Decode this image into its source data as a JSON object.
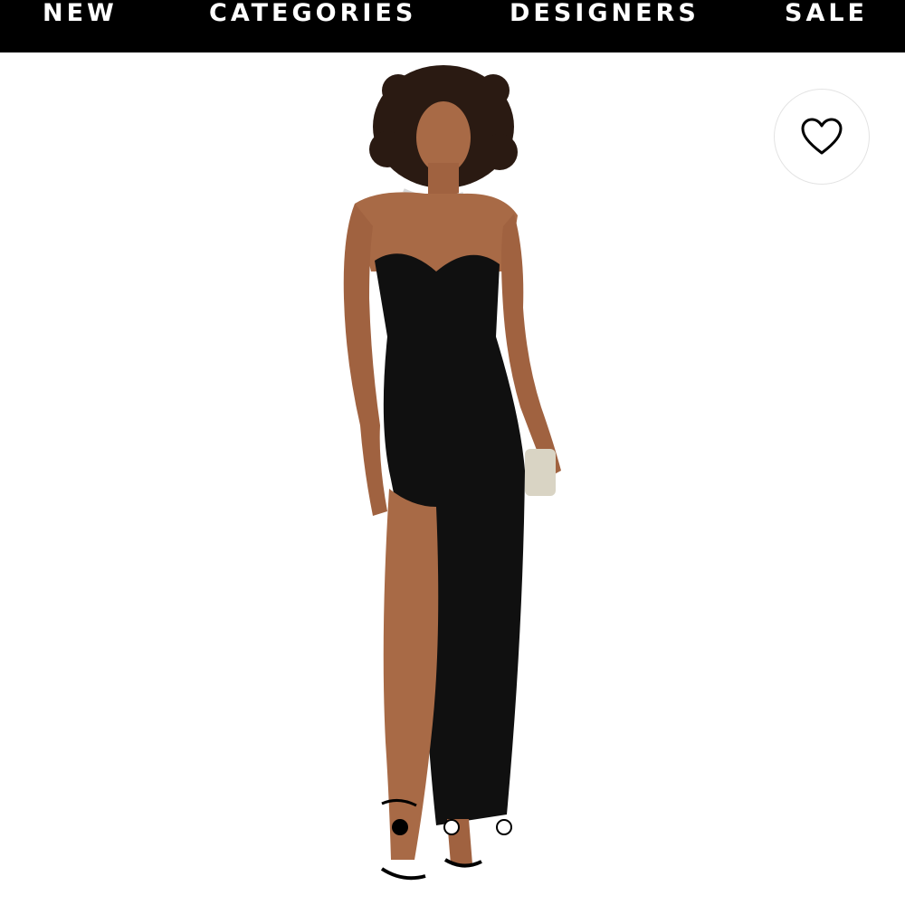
{
  "nav": {
    "items": [
      "NEW",
      "CATEGORIES",
      "DESIGNERS",
      "SALE"
    ]
  },
  "product": {
    "image_icon": "model-in-black-strapless-gown-image",
    "wishlist_icon": "heart-icon",
    "carousel": {
      "total": 3,
      "active": 1
    }
  },
  "colors": {
    "nav_bg": "#000000",
    "nav_text": "#ffffff",
    "dress": "#101010",
    "skin": "#a86a46"
  }
}
